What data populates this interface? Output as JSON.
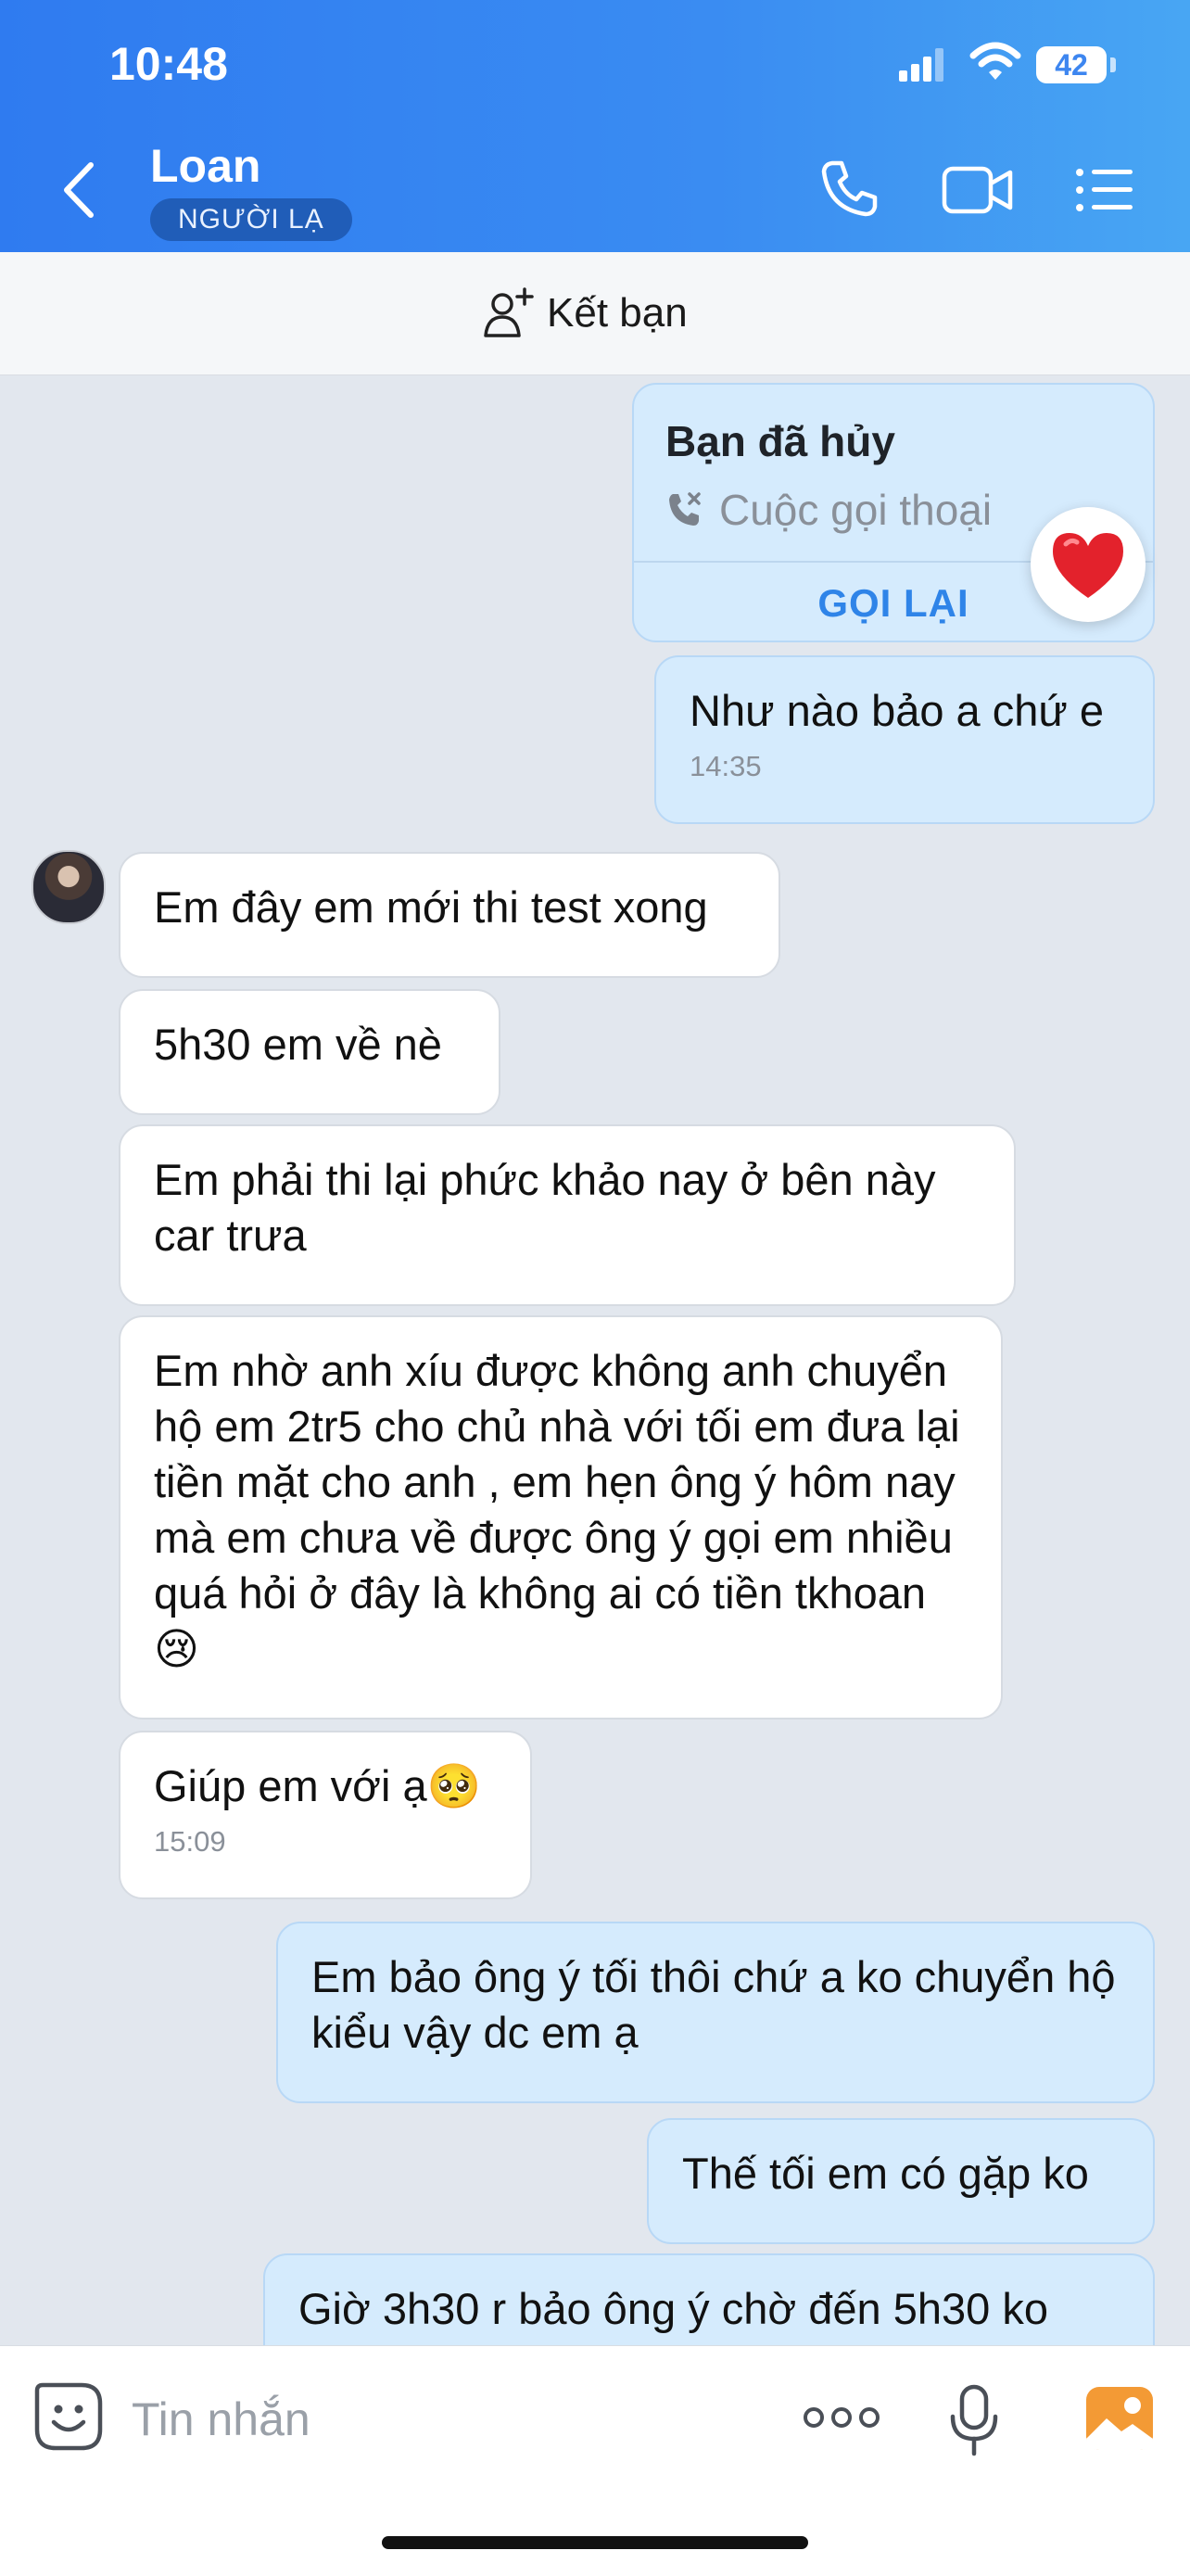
{
  "status_bar": {
    "time": "10:48",
    "battery": "42"
  },
  "header": {
    "contact_name": "Loan",
    "badge": "NGƯỜI LẠ"
  },
  "add_friend": {
    "label": "Kết bạn"
  },
  "call_card": {
    "title": "Bạn đã hủy",
    "subtitle": "Cuộc gọi thoại",
    "action": "GỌI LẠI",
    "reaction": "heart"
  },
  "messages": [
    {
      "direction": "out",
      "text": "Như nào bảo a chứ e",
      "time": "14:35"
    },
    {
      "direction": "in",
      "text": "Em đây em mới thi test xong"
    },
    {
      "direction": "in",
      "text": "5h30 em về nè"
    },
    {
      "direction": "in",
      "text": "Em phải thi lại phức khảo nay ở bên này car trưa"
    },
    {
      "direction": "in",
      "text": "Em nhờ anh xíu được không anh chuyển hộ em 2tr5 cho chủ nhà với tối em đưa lại tiền mặt cho anh , em hẹn ông ý hôm nay mà em chưa về được ông ý gọi em nhiều quá hỏi ở đây là không ai có tiền tkhoan 😢"
    },
    {
      "direction": "in",
      "text": "Giúp em với ạ🥺",
      "time": "15:09"
    },
    {
      "direction": "out",
      "text": "Em bảo ông ý tối thôi chứ a ko chuyển hộ kiểu vậy dc em ạ"
    },
    {
      "direction": "out",
      "text": "Thế tối em có gặp ko"
    },
    {
      "direction": "out",
      "text": "Giờ 3h30 r bảo ông ý chờ đến 5h30 ko"
    }
  ],
  "input": {
    "placeholder": "Tin nhắn"
  },
  "colors": {
    "header_start": "#2f7bf0",
    "header_end": "#48a6f3",
    "out_bubble": "#d5ebfd",
    "in_bubble": "#ffffff",
    "chat_bg": "#e2e7ee",
    "accent": "#2f84e8"
  }
}
